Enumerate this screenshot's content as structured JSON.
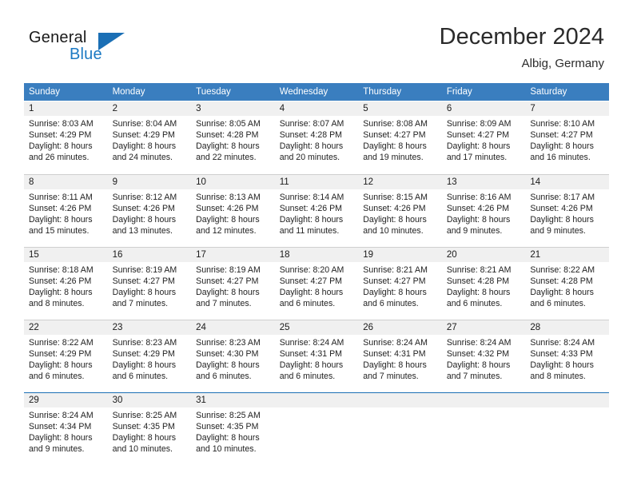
{
  "logo": {
    "word_top": "General",
    "word_bottom": "Blue",
    "triangle_color": "#1b6fb5",
    "blue_color": "#1b79c3"
  },
  "header": {
    "month_title": "December 2024",
    "location": "Albig, Germany"
  },
  "calendar": {
    "header_color": "#3a7ebf",
    "daynum_background": "#f0f0f0",
    "weekday_headers": [
      "Sunday",
      "Monday",
      "Tuesday",
      "Wednesday",
      "Thursday",
      "Friday",
      "Saturday"
    ],
    "weeks": [
      [
        {
          "day": "1",
          "sunrise": "Sunrise: 8:03 AM",
          "sunset": "Sunset: 4:29 PM",
          "daylight_line1": "Daylight: 8 hours",
          "daylight_line2": "and 26 minutes."
        },
        {
          "day": "2",
          "sunrise": "Sunrise: 8:04 AM",
          "sunset": "Sunset: 4:29 PM",
          "daylight_line1": "Daylight: 8 hours",
          "daylight_line2": "and 24 minutes."
        },
        {
          "day": "3",
          "sunrise": "Sunrise: 8:05 AM",
          "sunset": "Sunset: 4:28 PM",
          "daylight_line1": "Daylight: 8 hours",
          "daylight_line2": "and 22 minutes."
        },
        {
          "day": "4",
          "sunrise": "Sunrise: 8:07 AM",
          "sunset": "Sunset: 4:28 PM",
          "daylight_line1": "Daylight: 8 hours",
          "daylight_line2": "and 20 minutes."
        },
        {
          "day": "5",
          "sunrise": "Sunrise: 8:08 AM",
          "sunset": "Sunset: 4:27 PM",
          "daylight_line1": "Daylight: 8 hours",
          "daylight_line2": "and 19 minutes."
        },
        {
          "day": "6",
          "sunrise": "Sunrise: 8:09 AM",
          "sunset": "Sunset: 4:27 PM",
          "daylight_line1": "Daylight: 8 hours",
          "daylight_line2": "and 17 minutes."
        },
        {
          "day": "7",
          "sunrise": "Sunrise: 8:10 AM",
          "sunset": "Sunset: 4:27 PM",
          "daylight_line1": "Daylight: 8 hours",
          "daylight_line2": "and 16 minutes."
        }
      ],
      [
        {
          "day": "8",
          "sunrise": "Sunrise: 8:11 AM",
          "sunset": "Sunset: 4:26 PM",
          "daylight_line1": "Daylight: 8 hours",
          "daylight_line2": "and 15 minutes."
        },
        {
          "day": "9",
          "sunrise": "Sunrise: 8:12 AM",
          "sunset": "Sunset: 4:26 PM",
          "daylight_line1": "Daylight: 8 hours",
          "daylight_line2": "and 13 minutes."
        },
        {
          "day": "10",
          "sunrise": "Sunrise: 8:13 AM",
          "sunset": "Sunset: 4:26 PM",
          "daylight_line1": "Daylight: 8 hours",
          "daylight_line2": "and 12 minutes."
        },
        {
          "day": "11",
          "sunrise": "Sunrise: 8:14 AM",
          "sunset": "Sunset: 4:26 PM",
          "daylight_line1": "Daylight: 8 hours",
          "daylight_line2": "and 11 minutes."
        },
        {
          "day": "12",
          "sunrise": "Sunrise: 8:15 AM",
          "sunset": "Sunset: 4:26 PM",
          "daylight_line1": "Daylight: 8 hours",
          "daylight_line2": "and 10 minutes."
        },
        {
          "day": "13",
          "sunrise": "Sunrise: 8:16 AM",
          "sunset": "Sunset: 4:26 PM",
          "daylight_line1": "Daylight: 8 hours",
          "daylight_line2": "and 9 minutes."
        },
        {
          "day": "14",
          "sunrise": "Sunrise: 8:17 AM",
          "sunset": "Sunset: 4:26 PM",
          "daylight_line1": "Daylight: 8 hours",
          "daylight_line2": "and 9 minutes."
        }
      ],
      [
        {
          "day": "15",
          "sunrise": "Sunrise: 8:18 AM",
          "sunset": "Sunset: 4:26 PM",
          "daylight_line1": "Daylight: 8 hours",
          "daylight_line2": "and 8 minutes."
        },
        {
          "day": "16",
          "sunrise": "Sunrise: 8:19 AM",
          "sunset": "Sunset: 4:27 PM",
          "daylight_line1": "Daylight: 8 hours",
          "daylight_line2": "and 7 minutes."
        },
        {
          "day": "17",
          "sunrise": "Sunrise: 8:19 AM",
          "sunset": "Sunset: 4:27 PM",
          "daylight_line1": "Daylight: 8 hours",
          "daylight_line2": "and 7 minutes."
        },
        {
          "day": "18",
          "sunrise": "Sunrise: 8:20 AM",
          "sunset": "Sunset: 4:27 PM",
          "daylight_line1": "Daylight: 8 hours",
          "daylight_line2": "and 6 minutes."
        },
        {
          "day": "19",
          "sunrise": "Sunrise: 8:21 AM",
          "sunset": "Sunset: 4:27 PM",
          "daylight_line1": "Daylight: 8 hours",
          "daylight_line2": "and 6 minutes."
        },
        {
          "day": "20",
          "sunrise": "Sunrise: 8:21 AM",
          "sunset": "Sunset: 4:28 PM",
          "daylight_line1": "Daylight: 8 hours",
          "daylight_line2": "and 6 minutes."
        },
        {
          "day": "21",
          "sunrise": "Sunrise: 8:22 AM",
          "sunset": "Sunset: 4:28 PM",
          "daylight_line1": "Daylight: 8 hours",
          "daylight_line2": "and 6 minutes."
        }
      ],
      [
        {
          "day": "22",
          "sunrise": "Sunrise: 8:22 AM",
          "sunset": "Sunset: 4:29 PM",
          "daylight_line1": "Daylight: 8 hours",
          "daylight_line2": "and 6 minutes."
        },
        {
          "day": "23",
          "sunrise": "Sunrise: 8:23 AM",
          "sunset": "Sunset: 4:29 PM",
          "daylight_line1": "Daylight: 8 hours",
          "daylight_line2": "and 6 minutes."
        },
        {
          "day": "24",
          "sunrise": "Sunrise: 8:23 AM",
          "sunset": "Sunset: 4:30 PM",
          "daylight_line1": "Daylight: 8 hours",
          "daylight_line2": "and 6 minutes."
        },
        {
          "day": "25",
          "sunrise": "Sunrise: 8:24 AM",
          "sunset": "Sunset: 4:31 PM",
          "daylight_line1": "Daylight: 8 hours",
          "daylight_line2": "and 6 minutes."
        },
        {
          "day": "26",
          "sunrise": "Sunrise: 8:24 AM",
          "sunset": "Sunset: 4:31 PM",
          "daylight_line1": "Daylight: 8 hours",
          "daylight_line2": "and 7 minutes."
        },
        {
          "day": "27",
          "sunrise": "Sunrise: 8:24 AM",
          "sunset": "Sunset: 4:32 PM",
          "daylight_line1": "Daylight: 8 hours",
          "daylight_line2": "and 7 minutes."
        },
        {
          "day": "28",
          "sunrise": "Sunrise: 8:24 AM",
          "sunset": "Sunset: 4:33 PM",
          "daylight_line1": "Daylight: 8 hours",
          "daylight_line2": "and 8 minutes."
        }
      ],
      [
        {
          "day": "29",
          "sunrise": "Sunrise: 8:24 AM",
          "sunset": "Sunset: 4:34 PM",
          "daylight_line1": "Daylight: 8 hours",
          "daylight_line2": "and 9 minutes."
        },
        {
          "day": "30",
          "sunrise": "Sunrise: 8:25 AM",
          "sunset": "Sunset: 4:35 PM",
          "daylight_line1": "Daylight: 8 hours",
          "daylight_line2": "and 10 minutes."
        },
        {
          "day": "31",
          "sunrise": "Sunrise: 8:25 AM",
          "sunset": "Sunset: 4:35 PM",
          "daylight_line1": "Daylight: 8 hours",
          "daylight_line2": "and 10 minutes."
        },
        {
          "day": "",
          "sunrise": "",
          "sunset": "",
          "daylight_line1": "",
          "daylight_line2": ""
        },
        {
          "day": "",
          "sunrise": "",
          "sunset": "",
          "daylight_line1": "",
          "daylight_line2": ""
        },
        {
          "day": "",
          "sunrise": "",
          "sunset": "",
          "daylight_line1": "",
          "daylight_line2": ""
        },
        {
          "day": "",
          "sunrise": "",
          "sunset": "",
          "daylight_line1": "",
          "daylight_line2": ""
        }
      ]
    ]
  }
}
